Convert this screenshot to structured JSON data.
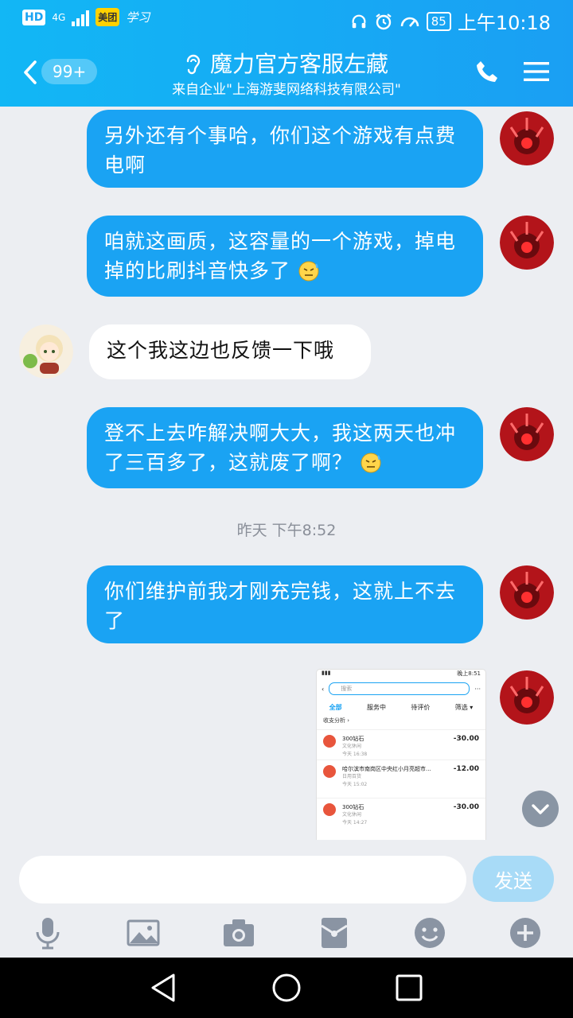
{
  "status_bar": {
    "hd": "HD",
    "network": "4G",
    "meituan": "美团",
    "xuexi": "学习",
    "battery": "85",
    "time": "上午10:18"
  },
  "header": {
    "unread_badge": "99+",
    "title": "魔力官方客服左藏",
    "subtitle": "来自企业\"上海游斐网络科技有限公司\""
  },
  "messages": [
    {
      "from": "me",
      "text": "另外还有个事哈，你们这个游戏有点费电啊"
    },
    {
      "from": "me",
      "text": "咱就这画质，这容量的一个游戏，掉电掉的比刷抖音快多了",
      "emoji": "sweat-smile-icon"
    },
    {
      "from": "other",
      "text": "这个我这边也反馈一下哦"
    },
    {
      "from": "me",
      "text": "登不上去咋解决啊大大，我这两天也冲了三百多了，这就废了啊？",
      "emoji": "sweat-smile-icon"
    },
    {
      "from": "me",
      "text": "你们维护前我才刚充完钱，这就上不去了"
    }
  ],
  "timestamp": "昨天 下午8:52",
  "screenshot_image": {
    "status_time": "晚上8:51",
    "search_placeholder": "搜索",
    "tabs": [
      "全部",
      "服务中",
      "待评价",
      "筛选 ▾"
    ],
    "section": "收支分析 ›",
    "rows": [
      {
        "title": "300钻石",
        "category": "文化休闲",
        "time": "今天 16:38",
        "amount": "-30.00"
      },
      {
        "title": "哈尔滨市南岗区中央红小月亮超市...",
        "category": "日用百货",
        "time": "今天 15:02",
        "amount": "-12.00"
      },
      {
        "title": "300钻石",
        "category": "文化休闲",
        "time": "今天 14:27",
        "amount": "-30.00"
      }
    ]
  },
  "input": {
    "placeholder": "",
    "send_label": "发送"
  },
  "toolbar": [
    "mic-icon",
    "image-icon",
    "camera-icon",
    "red-packet-icon",
    "emoji-icon",
    "plus-icon"
  ],
  "colors": {
    "header_start": "#12b7f5",
    "header_end": "#1a9ff3",
    "bubble_me": "#1aa3f3",
    "bubble_other": "#ffffff",
    "background": "#eceef2"
  }
}
